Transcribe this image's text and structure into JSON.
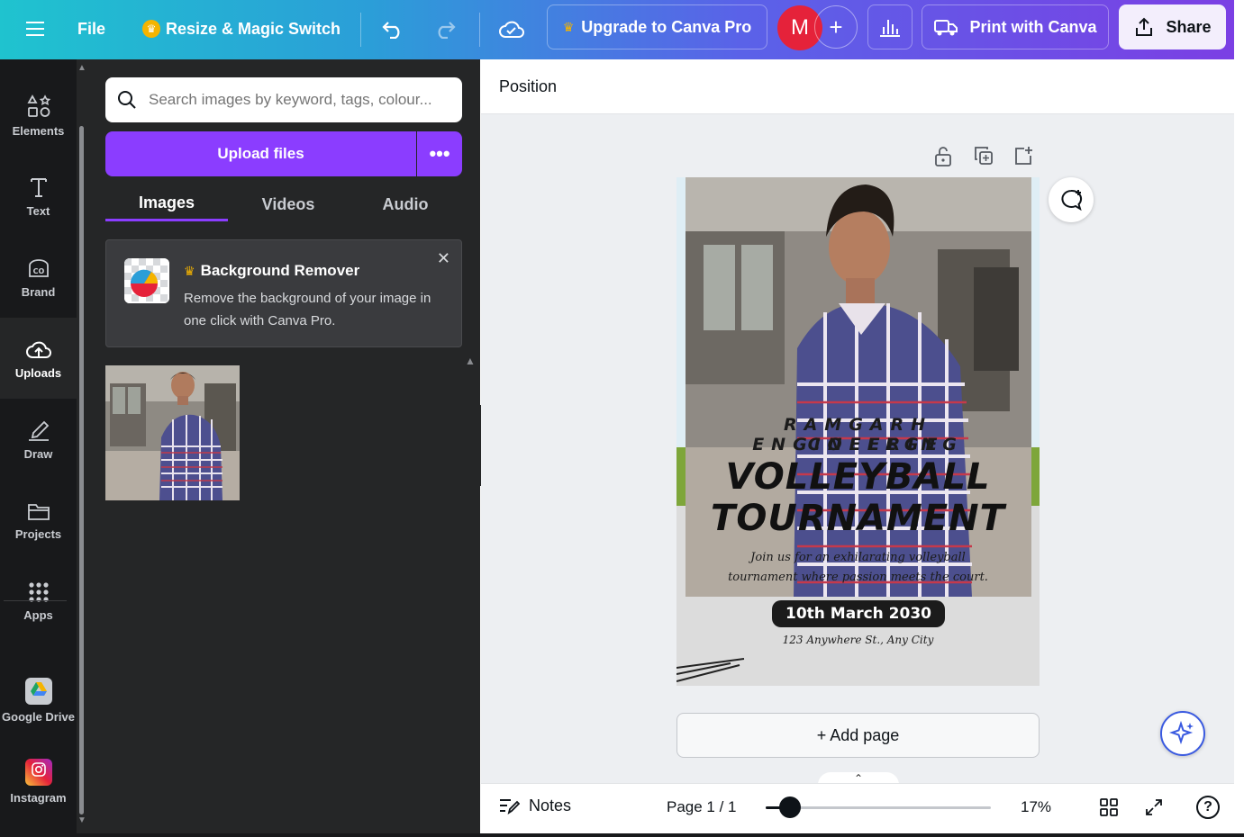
{
  "topbar": {
    "file": "File",
    "resize": "Resize & Magic Switch",
    "upgrade": "Upgrade to Canva Pro",
    "avatar": "M",
    "print": "Print with Canva",
    "share": "Share"
  },
  "nav": {
    "elements": "Elements",
    "text": "Text",
    "brand": "Brand",
    "uploads": "Uploads",
    "draw": "Draw",
    "projects": "Projects",
    "apps": "Apps",
    "google_drive": "Google Drive",
    "instagram": "Instagram"
  },
  "panel": {
    "search_placeholder": "Search images by keyword, tags, colour...",
    "upload_label": "Upload files",
    "tabs": [
      "Images",
      "Videos",
      "Audio"
    ],
    "promo_title": "Background Remover",
    "promo_text": "Remove the background of your image in one click with Canva Pro."
  },
  "editor": {
    "position_label": "Position",
    "add_page": "+ Add page",
    "notes": "Notes",
    "page_indicator": "Page 1 / 1",
    "zoom": "17%",
    "zoom_level": 0.17
  },
  "poster": {
    "college": "RAMGARH ENGINEERING",
    "college2": "COLLEGE",
    "title1": "VOLLEYBALL",
    "title2": "TOURNAMENT",
    "tagline1": "Join us for an exhilarating volleyball",
    "tagline2": "tournament where passion meets the court.",
    "date": "10th March 2030",
    "address": "123 Anywhere St., Any City"
  },
  "colors": {
    "accent": "#8b3dff",
    "avatar": "#e5223a"
  }
}
